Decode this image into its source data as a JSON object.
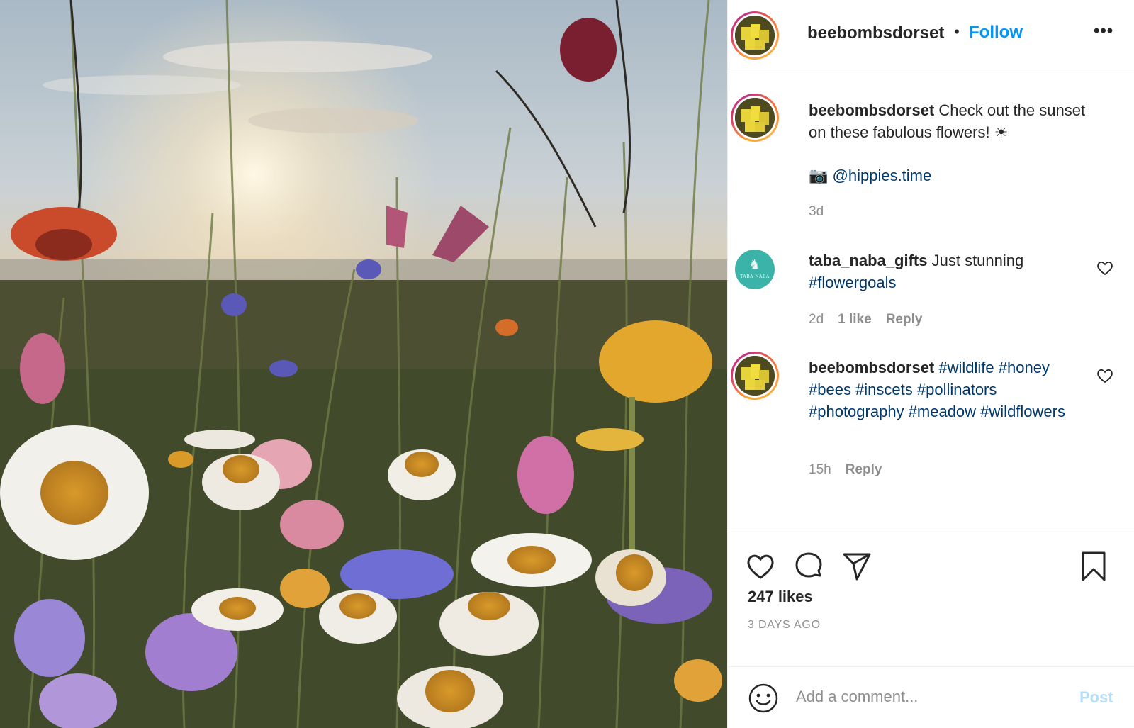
{
  "post": {
    "image": {
      "alt": "",
      "icon": "wildflower-photo"
    },
    "header": {
      "username": "beebombsdorset",
      "separator": "•",
      "follow_label": "Follow",
      "more_icon": "more-icon",
      "more_label": "•••"
    },
    "caption": {
      "username": "beebombsdorset",
      "text": " Check out the sunset on these fabulous flowers! ☀",
      "camera_emoji": "📷 ",
      "mention": "@hippies.time",
      "time": "3d"
    },
    "comments": [
      {
        "username": "taba_naba_gifts",
        "text": " Just stunning ",
        "hashtag": "#flowergoals",
        "time": "2d",
        "likes": "1 like",
        "reply_label": "Reply",
        "avatar_text": "TABA NABA"
      },
      {
        "username": "beebombsdorset",
        "hashtags": "#wildlife #honey #bees #inscets #pollinators #photography #meadow #wildflowers",
        "time": "15h",
        "reply_label": "Reply"
      }
    ],
    "actions": {
      "like_icon": "heart-icon",
      "comment_icon": "comment-icon",
      "share_icon": "paper-plane-icon",
      "save_icon": "bookmark-icon"
    },
    "likes": "247 likes",
    "posted_ago": "3 DAYS AGO",
    "add_comment": {
      "placeholder": "Add a comment...",
      "post_label": "Post",
      "emoji_icon": "smiley-icon"
    },
    "colors": {
      "link_blue": "#0095f6",
      "hashtag_navy": "#00376b",
      "muted_gray": "#8e8e8e",
      "post_disabled": "#b2dffc",
      "text": "#262626"
    }
  }
}
